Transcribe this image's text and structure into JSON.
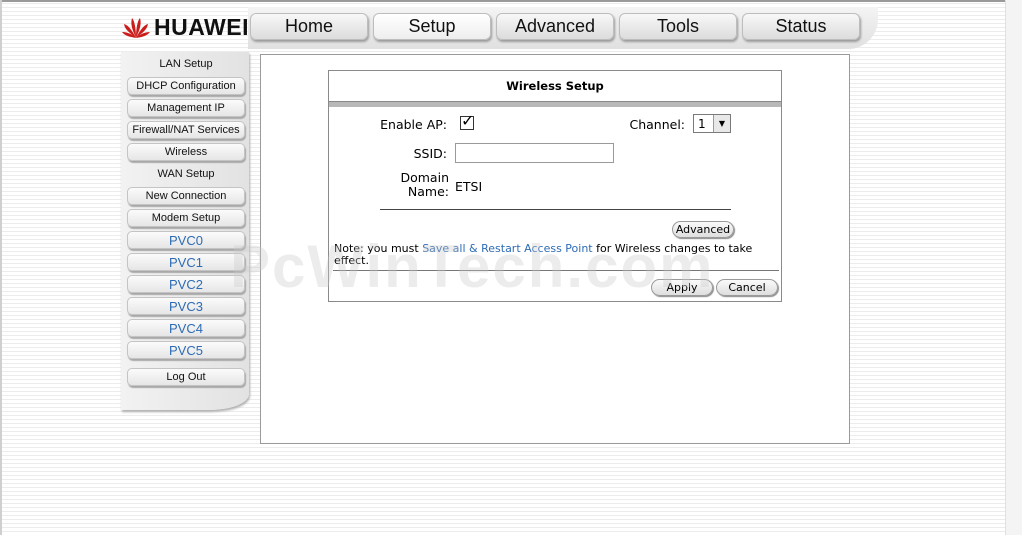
{
  "brand": {
    "name": "HUAWEI",
    "logo_icon": "huawei-petal-icon",
    "logo_color": "#cc1b1b"
  },
  "nav": {
    "tabs": [
      {
        "label": "Home"
      },
      {
        "label": "Setup",
        "active": true
      },
      {
        "label": "Advanced"
      },
      {
        "label": "Tools"
      },
      {
        "label": "Status"
      }
    ]
  },
  "sidebar": {
    "items": [
      {
        "label": "LAN Setup",
        "type": "label"
      },
      {
        "label": "DHCP Configuration",
        "type": "button"
      },
      {
        "label": "Management IP",
        "type": "button"
      },
      {
        "label": "Firewall/NAT Services",
        "type": "button"
      },
      {
        "label": "Wireless",
        "type": "button"
      },
      {
        "label": "WAN Setup",
        "type": "label"
      },
      {
        "label": "New Connection",
        "type": "button"
      },
      {
        "label": "Modem Setup",
        "type": "button"
      },
      {
        "label": "PVC0",
        "type": "pvc"
      },
      {
        "label": "PVC1",
        "type": "pvc"
      },
      {
        "label": "PVC2",
        "type": "pvc"
      },
      {
        "label": "PVC3",
        "type": "pvc"
      },
      {
        "label": "PVC4",
        "type": "pvc"
      },
      {
        "label": "PVC5",
        "type": "pvc"
      }
    ],
    "logout": "Log Out"
  },
  "wireless": {
    "title": "Wireless Setup",
    "enable_ap_label": "Enable AP:",
    "enable_ap_checked": true,
    "check_mark": "✓",
    "channel_label": "Channel:",
    "channel_value": "1",
    "ssid_label": "SSID:",
    "ssid_value": "",
    "domain_label_line1": "Domain",
    "domain_label_line2": "Name:",
    "domain_value": "ETSI",
    "advanced_button": "Advanced",
    "note_prefix": "Note: you must ",
    "note_link": "Save all & Restart Access Point",
    "note_suffix": " for Wireless changes to take effect.",
    "apply_button": "Apply",
    "cancel_button": "Cancel"
  },
  "watermark": "PcWinTech.com"
}
